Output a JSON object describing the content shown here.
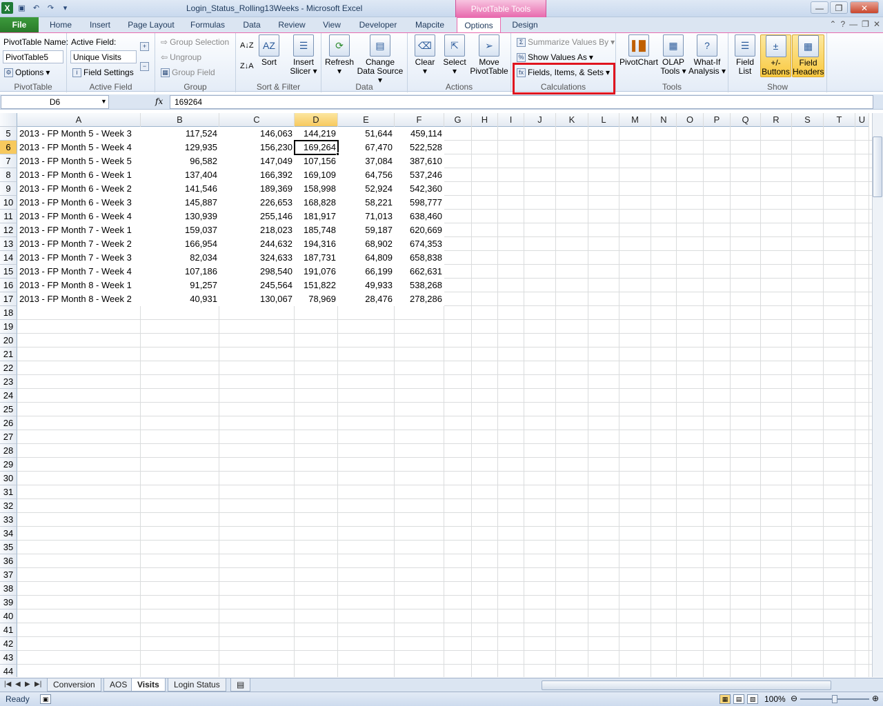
{
  "app": {
    "title": "Login_Status_Rolling13Weeks  -  Microsoft Excel",
    "context_tab": "PivotTable Tools"
  },
  "tabs": [
    "File",
    "Home",
    "Insert",
    "Page Layout",
    "Formulas",
    "Data",
    "Review",
    "View",
    "Developer",
    "Mapcite",
    "Options",
    "Design"
  ],
  "active_tab": "Options",
  "ribbon": {
    "pivottable": {
      "name_label": "PivotTable Name:",
      "name_value": "PivotTable5",
      "options": "Options",
      "group": "PivotTable"
    },
    "active_field": {
      "label": "Active Field:",
      "value": "Unique Visits",
      "settings": "Field Settings",
      "group": "Active Field"
    },
    "group": {
      "group_selection": "Group Selection",
      "ungroup": "Ungroup",
      "group_field": "Group Field",
      "group": "Group"
    },
    "sort": {
      "sort": "Sort",
      "group": "Sort & Filter",
      "insert_slicer": "Insert Slicer"
    },
    "data": {
      "refresh": "Refresh",
      "change_source": "Change Data Source",
      "group": "Data"
    },
    "actions": {
      "clear": "Clear",
      "select": "Select",
      "move": "Move PivotTable",
      "group": "Actions"
    },
    "calculations": {
      "summarize": "Summarize Values By",
      "show_values": "Show Values As",
      "fields_items": "Fields, Items, & Sets",
      "group": "Calculations"
    },
    "tools": {
      "pivotchart": "PivotChart",
      "olap": "OLAP Tools",
      "whatif": "What-If Analysis",
      "group": "Tools"
    },
    "show": {
      "field_list": "Field List",
      "buttons": "+/- Buttons",
      "headers": "Field Headers",
      "group": "Show"
    }
  },
  "formula_bar": {
    "name_box": "D6",
    "fx": "fx",
    "value": "169264"
  },
  "columns": [
    "A",
    "B",
    "C",
    "D",
    "E",
    "F",
    "G",
    "H",
    "I",
    "J",
    "K",
    "L",
    "M",
    "N",
    "O",
    "P",
    "Q",
    "R",
    "S",
    "T",
    "U"
  ],
  "rows": [
    {
      "n": "5",
      "a": "2013 - FP Month  5 - Week 3",
      "b": "117,524",
      "c": "146,063",
      "d": "144,219",
      "e": "51,644",
      "f": "459,114"
    },
    {
      "n": "6",
      "a": "2013 - FP Month  5 - Week 4",
      "b": "129,935",
      "c": "156,230",
      "d": "169,264",
      "e": "67,470",
      "f": "522,528"
    },
    {
      "n": "7",
      "a": "2013 - FP Month  5 - Week 5",
      "b": "96,582",
      "c": "147,049",
      "d": "107,156",
      "e": "37,084",
      "f": "387,610"
    },
    {
      "n": "8",
      "a": "2013 - FP Month  6 - Week 1",
      "b": "137,404",
      "c": "166,392",
      "d": "169,109",
      "e": "64,756",
      "f": "537,246"
    },
    {
      "n": "9",
      "a": "2013 - FP Month  6 - Week 2",
      "b": "141,546",
      "c": "189,369",
      "d": "158,998",
      "e": "52,924",
      "f": "542,360"
    },
    {
      "n": "10",
      "a": "2013 - FP Month  6 - Week 3",
      "b": "145,887",
      "c": "226,653",
      "d": "168,828",
      "e": "58,221",
      "f": "598,777"
    },
    {
      "n": "11",
      "a": "2013 - FP Month  6 - Week 4",
      "b": "130,939",
      "c": "255,146",
      "d": "181,917",
      "e": "71,013",
      "f": "638,460"
    },
    {
      "n": "12",
      "a": "2013 - FP Month  7 - Week 1",
      "b": "159,037",
      "c": "218,023",
      "d": "185,748",
      "e": "59,187",
      "f": "620,669"
    },
    {
      "n": "13",
      "a": "2013 - FP Month  7 - Week 2",
      "b": "166,954",
      "c": "244,632",
      "d": "194,316",
      "e": "68,902",
      "f": "674,353"
    },
    {
      "n": "14",
      "a": "2013 - FP Month  7 - Week 3",
      "b": "82,034",
      "c": "324,633",
      "d": "187,731",
      "e": "64,809",
      "f": "658,838"
    },
    {
      "n": "15",
      "a": "2013 - FP Month  7 - Week 4",
      "b": "107,186",
      "c": "298,540",
      "d": "191,076",
      "e": "66,199",
      "f": "662,631"
    },
    {
      "n": "16",
      "a": "2013 - FP Month  8 - Week 1",
      "b": "91,257",
      "c": "245,564",
      "d": "151,822",
      "e": "49,933",
      "f": "538,268"
    },
    {
      "n": "17",
      "a": "2013 - FP Month  8 - Week 2",
      "b": "40,931",
      "c": "130,067",
      "d": "78,969",
      "e": "28,476",
      "f": "278,286"
    }
  ],
  "empty_rows": [
    "18",
    "19",
    "20",
    "21",
    "22",
    "23",
    "24",
    "25",
    "26",
    "27",
    "28",
    "29",
    "30",
    "31",
    "32",
    "33",
    "34",
    "35",
    "36",
    "37",
    "38",
    "39",
    "40",
    "41",
    "42",
    "43",
    "44"
  ],
  "sheets": [
    "Conversion",
    "AOS",
    "Visits",
    "Login Status"
  ],
  "active_sheet": "Visits",
  "status": {
    "text": "Ready",
    "zoom": "100%"
  }
}
